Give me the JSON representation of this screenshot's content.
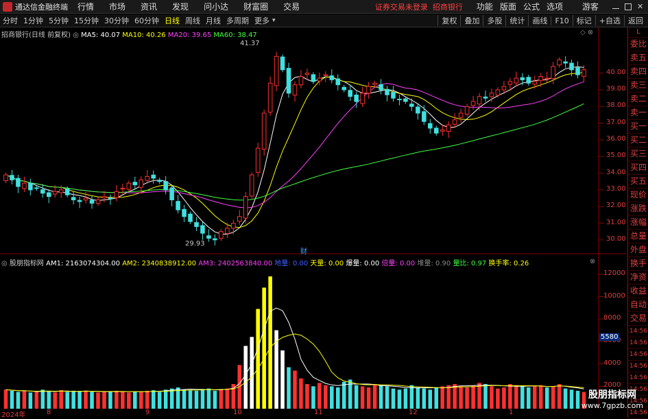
{
  "titlebar": {
    "app_name": "通达信金融终端",
    "menus": [
      "行情",
      "市场",
      "资讯",
      "发现",
      "问小达",
      "财富圈",
      "交易"
    ],
    "notice": "证券交易未登录",
    "bank": "招商银行",
    "right_menus": [
      "功能",
      "版面",
      "公式",
      "选项"
    ],
    "guest": "游客"
  },
  "toolbar": {
    "periods": [
      "分时",
      "1分钟",
      "5分钟",
      "15分钟",
      "30分钟",
      "60分钟",
      "日线",
      "周线",
      "月线",
      "多周期",
      "更多"
    ],
    "active_period": "日线",
    "buttons": [
      "复权",
      "叠加",
      "多股",
      "统计",
      "画线",
      "F10",
      "标记",
      "+自选",
      "返回"
    ]
  },
  "main_legend": {
    "stock": "招商银行(日线 前复权)",
    "ma5": "MA5: 40.07",
    "ma10": "MA10: 40.26",
    "ma20": "MA20: 39.65",
    "ma60": "MA60: 38.47"
  },
  "annotations": {
    "high": "41.37",
    "low": "29.93",
    "fin_marker": "财"
  },
  "price_axis": [
    "40.00",
    "39.00",
    "38.00",
    "37.00",
    "36.00",
    "35.00",
    "34.00",
    "33.00",
    "32.00",
    "31.00",
    "30.00"
  ],
  "sub_legend": {
    "name": "股朋指标网",
    "am1": "AM1: 2163074304.00",
    "am2": "AM2: 2340838912.00",
    "am3": "AM3: 2402563840.00",
    "jiliang": "地量: 0.00",
    "tianliang": "天量: 0.00",
    "baoliang": "爆量: 0.00",
    "beiliang": "倍量: 0.00",
    "duiliang": "堆量: 0.90",
    "liangbi": "量比: 0.97",
    "huanshou": "换手率: 0.26"
  },
  "vol_axis": [
    "12000",
    "10000",
    "8000",
    "6000",
    "4000",
    "2000"
  ],
  "vol_marker": "5580",
  "date_axis": [
    "2024年",
    "8",
    "9",
    "10",
    "11",
    "12",
    "1"
  ],
  "right_panel": [
    "L",
    "委比",
    "卖五",
    "卖四",
    "卖三",
    "卖二",
    "卖一",
    "买一",
    "买二",
    "买三",
    "买四",
    "买五",
    "现价",
    "涨跌",
    "涨幅",
    "总量",
    "外盘",
    "换手",
    "净资",
    "收益",
    "自动",
    "交易",
    "14:56",
    "14:56",
    "14:56",
    "14:56",
    "14:56",
    "14:56",
    "14:56",
    "14:56"
  ],
  "watermark": {
    "line1": "股朋指标网",
    "line2": "www.7gpzb.com"
  },
  "colors": {
    "up": "#ff3030",
    "down": "#40e0e0",
    "ma5": "#ffffff",
    "ma10": "#ffff00",
    "ma20": "#ff40ff",
    "ma60": "#40ff40"
  },
  "chart_data": {
    "type": "candlestick",
    "ylim": [
      29.5,
      42.0
    ],
    "closes": [
      33.9,
      33.6,
      33.2,
      33.4,
      33.0,
      33.1,
      32.8,
      32.6,
      32.9,
      33.0,
      32.7,
      32.4,
      32.3,
      32.5,
      32.2,
      32.4,
      32.6,
      32.5,
      32.9,
      33.1,
      33.4,
      33.3,
      33.6,
      33.8,
      33.7,
      33.5,
      33.0,
      32.4,
      31.8,
      31.4,
      31.1,
      30.8,
      30.4,
      30.1,
      30.0,
      30.5,
      30.7,
      31.0,
      31.4,
      32.6,
      33.9,
      35.5,
      37.6,
      39.4,
      41.0,
      40.2,
      38.8,
      39.3,
      39.8,
      40.0,
      39.5,
      39.7,
      39.9,
      39.6,
      39.3,
      39.0,
      38.6,
      38.3,
      38.8,
      39.2,
      39.4,
      39.0,
      38.7,
      38.5,
      38.4,
      38.3,
      38.0,
      37.6,
      37.1,
      36.7,
      36.4,
      36.6,
      36.9,
      37.2,
      37.6,
      38.0,
      38.3,
      38.6,
      38.5,
      38.8,
      39.0,
      39.2,
      39.5,
      39.7,
      39.6,
      39.4,
      39.5,
      39.8,
      39.7,
      40.4,
      40.8,
      40.6,
      40.2,
      39.9,
      40.2
    ],
    "volumes": [
      1700,
      1600,
      1500,
      1600,
      1450,
      1500,
      1700,
      1550,
      1450,
      1650,
      1500,
      1600,
      1550,
      1600,
      1500,
      1450,
      1500,
      1550,
      1600,
      1500,
      1450,
      1550,
      1500,
      1600,
      1650,
      1500,
      1700,
      1800,
      1900,
      1700,
      1650,
      1600,
      1750,
      1800,
      1600,
      1700,
      1800,
      2200,
      3900,
      5600,
      6400,
      8900,
      10800,
      11800,
      7000,
      5200,
      3700,
      3400,
      2700,
      2200,
      2000,
      2300,
      2100,
      2000,
      1900,
      2400,
      2600,
      2100,
      2000,
      1900,
      2200,
      2100,
      2000,
      1800,
      1700,
      1800,
      2100,
      1900,
      1800,
      1700,
      1900,
      2000,
      2100,
      2200,
      2000,
      1900,
      2100,
      2300,
      2200,
      2000,
      1800,
      1900,
      2200,
      2100,
      2000,
      1900,
      2000,
      2100,
      1900,
      2000,
      2200,
      1800,
      1700,
      1600,
      1500
    ]
  }
}
